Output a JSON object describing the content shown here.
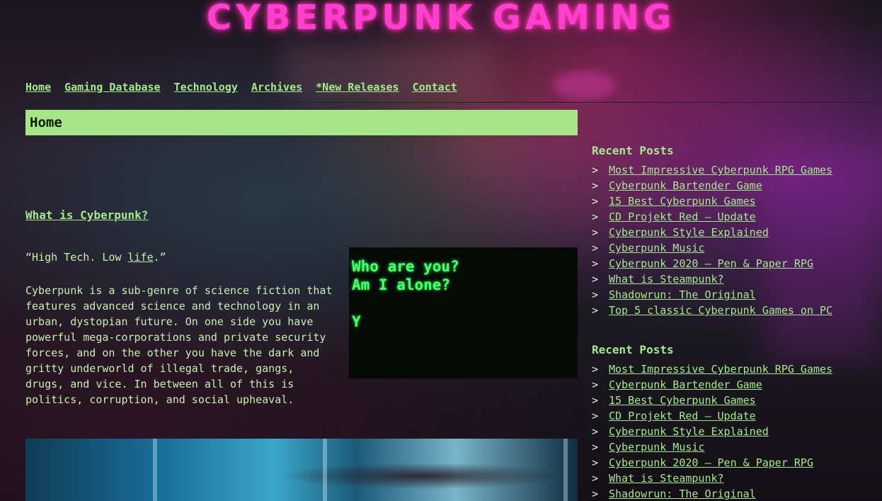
{
  "header": {
    "site_title": "CYBERPUNK GAMING"
  },
  "nav": {
    "items": [
      {
        "label": "Home"
      },
      {
        "label": "Gaming Database"
      },
      {
        "label": "Technology"
      },
      {
        "label": "Archives"
      },
      {
        "label": "*New Releases"
      },
      {
        "label": "Contact"
      }
    ]
  },
  "page": {
    "title": "Home"
  },
  "post": {
    "title": "What is Cyberpunk?",
    "quote_pre": "“High Tech. Low ",
    "quote_link": "life",
    "quote_post": ".”",
    "body": "Cyberpunk is a sub-genre of science fiction that features advanced science and technology in an urban, dystopian future.  On one side you have powerful mega-corporations and private security forces, and on the other you have the dark and gritty underworld of illegal trade, gangs, drugs, and vice.  In between all of this is politics, corruption, and social upheaval."
  },
  "terminal": {
    "line1": "Who are you?",
    "line2": "Am I alone?",
    "line3": "Y"
  },
  "sidebar": {
    "widget1": {
      "heading": "Recent Posts",
      "arrow": ">",
      "items": [
        "Most Impressive Cyberpunk RPG Games",
        "Cyberpunk Bartender Game",
        "15 Best Cyberpunk Games",
        "CD Projekt Red – Update",
        "Cyberpunk Style Explained",
        "Cyberpunk Music",
        "Cyberpunk 2020 – Pen & Paper RPG",
        "What is Steampunk?",
        "Shadowrun: The Original",
        "Top 5 classic Cyberpunk Games on PC"
      ]
    },
    "widget2": {
      "heading": "Recent Posts",
      "arrow": ">",
      "items": [
        "Most Impressive Cyberpunk RPG Games",
        "Cyberpunk Bartender Game",
        "15 Best Cyberpunk Games",
        "CD Projekt Red – Update",
        "Cyberpunk Style Explained",
        "Cyberpunk Music",
        "Cyberpunk 2020 – Pen & Paper RPG",
        "What is Steampunk?",
        "Shadowrun: The Original"
      ]
    }
  }
}
